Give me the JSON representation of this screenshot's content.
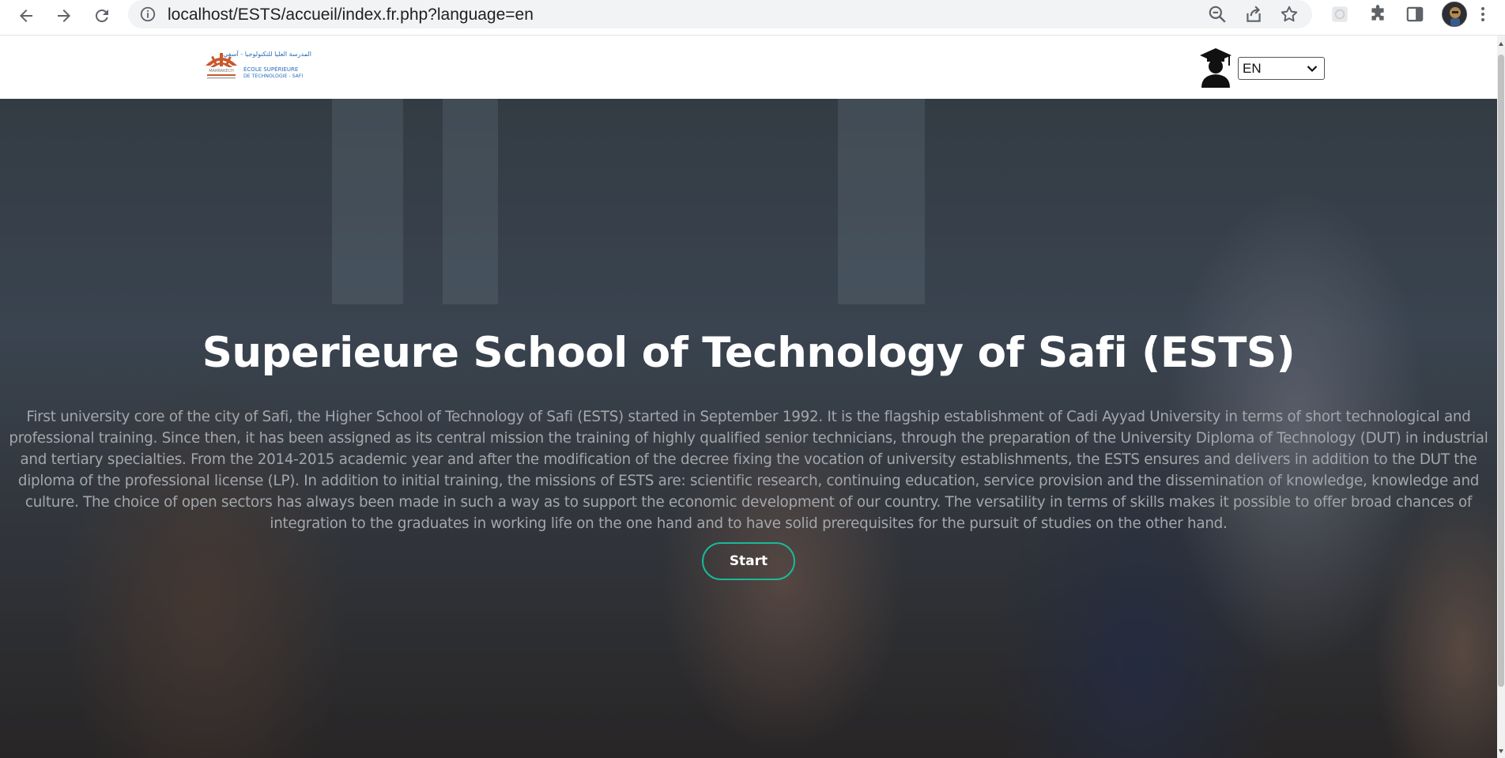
{
  "browser": {
    "url": "localhost/ESTS/accueil/index.fr.php?language=en",
    "icons": [
      "back-icon",
      "forward-icon",
      "reload-icon",
      "info-icon",
      "zoom-out-icon",
      "share-icon",
      "bookmark-star-icon",
      "extension-placeholder-icon",
      "puzzle-icon",
      "side-panel-icon",
      "profile-avatar",
      "menu-kebab-icon"
    ]
  },
  "header": {
    "logo_text_top": "المدرسة العليا للتكنولوجيا - آسفي",
    "logo_text_school": "ÉCOLE SUPÉRIEURE",
    "logo_text_sub": "DE TECHNOLOGIE - SAFI",
    "logo_text_uni": "MARRAKECH",
    "language_value": "EN"
  },
  "hero": {
    "title": "Superieure School of Technology of Safi (ESTS)",
    "text": "First university core of the city of Safi, the Higher School of Technology of Safi (ESTS) started in September 1992. It is the flagship establishment of Cadi Ayyad University in terms of short technological and professional training. Since then, it has been assigned as its central mission the training of highly qualified senior technicians, through the preparation of the University Diploma of Technology (DUT) in industrial and tertiary specialties. From the 2014-2015 academic year and after the modification of the decree fixing the vocation of university establishments, the ESTS ensures and delivers in addition to the DUT the diploma of the professional license (LP). In addition to initial training, the missions of ESTS are: scientific research, continuing education, service provision and the dissemination of knowledge, knowledge and culture. The choice of open sectors has always been made in such a way as to support the economic development of our country. The versatility in terms of skills makes it possible to offer broad chances of integration to the graduates in working life on the one hand and to have solid prerequisites for the pursuit of studies on the other hand.",
    "start_label": "Start"
  },
  "colors": {
    "accent": "#1bb89a",
    "logo_orange": "#c8582a",
    "logo_blue": "#2a6db5"
  }
}
